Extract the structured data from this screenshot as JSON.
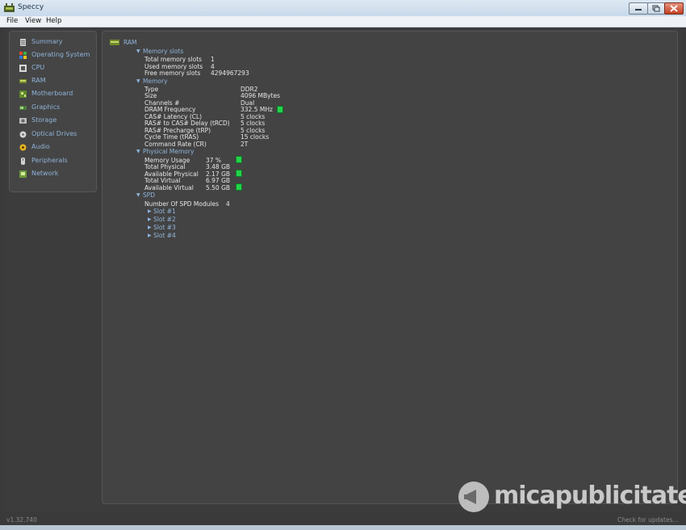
{
  "window": {
    "title": "Speccy"
  },
  "menu": [
    "File",
    "View",
    "Help"
  ],
  "sidebar": {
    "items": [
      {
        "label": "Summary",
        "icon": "summary-icon"
      },
      {
        "label": "Operating System",
        "icon": "windows-logo-icon"
      },
      {
        "label": "CPU",
        "icon": "cpu-icon"
      },
      {
        "label": "RAM",
        "icon": "ram-icon"
      },
      {
        "label": "Motherboard",
        "icon": "motherboard-icon"
      },
      {
        "label": "Graphics",
        "icon": "graphics-card-icon"
      },
      {
        "label": "Storage",
        "icon": "storage-icon"
      },
      {
        "label": "Optical Drives",
        "icon": "optical-drive-icon"
      },
      {
        "label": "Audio",
        "icon": "audio-icon"
      },
      {
        "label": "Peripherals",
        "icon": "peripherals-icon"
      },
      {
        "label": "Network",
        "icon": "network-icon"
      }
    ]
  },
  "content": {
    "title": "RAM",
    "memory_slots": {
      "header": "Memory slots",
      "rows": [
        {
          "label": "Total memory slots",
          "value": "1"
        },
        {
          "label": "Used memory slots",
          "value": "4"
        },
        {
          "label": "Free memory slots",
          "value": "4294967293"
        }
      ]
    },
    "memory": {
      "header": "Memory",
      "rows": [
        {
          "label": "Type",
          "value": "DDR2"
        },
        {
          "label": "Size",
          "value": "4096 MBytes"
        },
        {
          "label": "Channels #",
          "value": "Dual"
        },
        {
          "label": "DRAM Frequency",
          "value": "332.5 MHz"
        },
        {
          "label": "CAS# Latency (CL)",
          "value": "5 clocks"
        },
        {
          "label": "RAS# to CAS# Delay (tRCD)",
          "value": "5 clocks"
        },
        {
          "label": "RAS# Precharge (tRP)",
          "value": "5 clocks"
        },
        {
          "label": "Cycle Time (tRAS)",
          "value": "15 clocks"
        },
        {
          "label": "Command Rate (CR)",
          "value": "2T"
        }
      ]
    },
    "physical_memory": {
      "header": "Physical Memory",
      "rows": [
        {
          "label": "Memory Usage",
          "value": "37 %"
        },
        {
          "label": "Total Physical",
          "value": "3.48 GB"
        },
        {
          "label": "Available Physical",
          "value": "2.17 GB"
        },
        {
          "label": "Total Virtual",
          "value": "6.97 GB"
        },
        {
          "label": "Available Virtual",
          "value": "5.50 GB"
        }
      ]
    },
    "spd": {
      "header": "SPD",
      "modules_label": "Number Of SPD Modules",
      "modules_value": "4",
      "slots": [
        "Slot #1",
        "Slot #2",
        "Slot #3",
        "Slot #4"
      ]
    }
  },
  "status": {
    "version": "v1.32.740",
    "update": "Check for updates..."
  },
  "watermark": "micapublicitate",
  "colors": {
    "link": "#8fb3d9",
    "indicator": "#22d34a",
    "background": "#3c3c3c"
  }
}
